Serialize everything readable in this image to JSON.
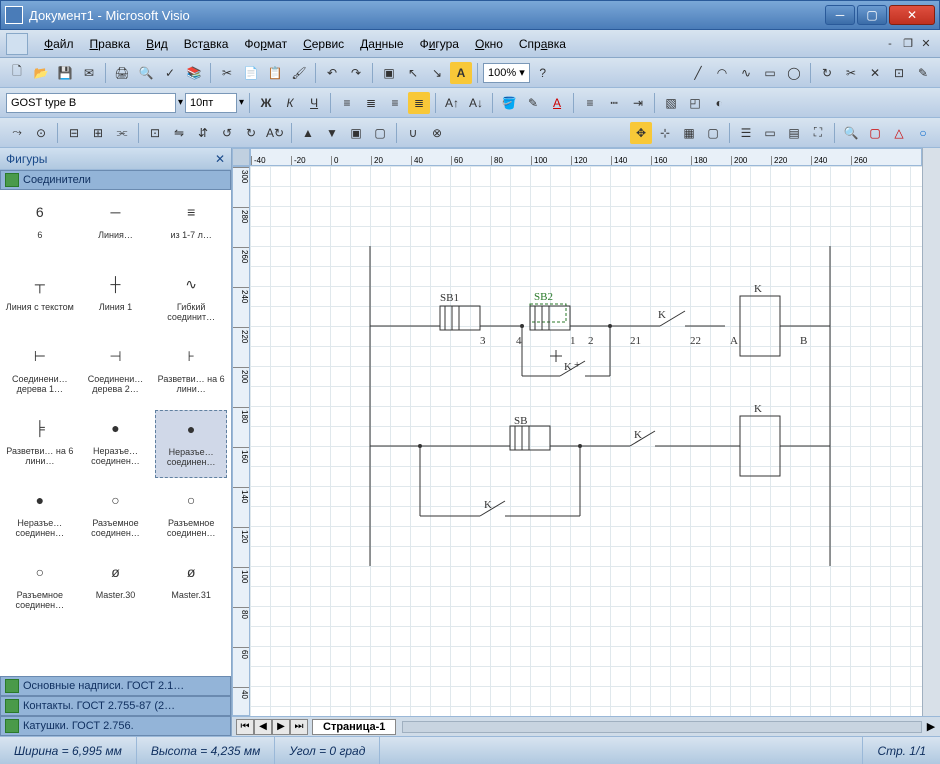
{
  "title": "Документ1 - Microsoft Visio",
  "menu": [
    "Файл",
    "Правка",
    "Вид",
    "Вставка",
    "Формат",
    "Сервис",
    "Данные",
    "Фигура",
    "Окно",
    "Справка"
  ],
  "font": {
    "name": "GOST type B",
    "size": "10пт"
  },
  "zoom": "100%",
  "shapes_panel": {
    "title": "Фигуры",
    "active_stencil": "Соединители",
    "items": [
      {
        "label": "6",
        "sub": ""
      },
      {
        "label": "Линия…",
        "sub": ""
      },
      {
        "label": "из 1-7 л…",
        "sub": ""
      },
      {
        "label": "Линия с текстом",
        "sub": ""
      },
      {
        "label": "Линия 1",
        "sub": ""
      },
      {
        "label": "Гибкий соединит…",
        "sub": ""
      },
      {
        "label": "Соединени… дерева 1…",
        "sub": ""
      },
      {
        "label": "Соединени… дерева 2…",
        "sub": ""
      },
      {
        "label": "Разветви… на 6 лини…",
        "sub": ""
      },
      {
        "label": "Разветви… на 6 лини…",
        "sub": ""
      },
      {
        "label": "Неразъе… соединен…",
        "sub": ""
      },
      {
        "label": "Неразъе… соединен…",
        "sub": "",
        "selected": true
      },
      {
        "label": "Неразъе… соединен…",
        "sub": ""
      },
      {
        "label": "Разъемное соединен…",
        "sub": ""
      },
      {
        "label": "Разъемное соединен…",
        "sub": ""
      },
      {
        "label": "Разъемное соединен…",
        "sub": ""
      },
      {
        "label": "Master.30",
        "sub": ""
      },
      {
        "label": "Master.31",
        "sub": ""
      }
    ],
    "other_stencils": [
      "Основные надписи. ГОСТ 2.1…",
      "Контакты. ГОСТ 2.755-87 (2…",
      "Катушки. ГОСТ 2.756."
    ]
  },
  "diagram": {
    "labels": {
      "sb1": "SB1",
      "sb2": "SB2",
      "sb": "SB",
      "k": "K"
    },
    "nodes": [
      "1",
      "2",
      "3",
      "4",
      "21",
      "22",
      "A",
      "B"
    ]
  },
  "page_tab": "Страница-1",
  "status": {
    "width": "Ширина = 6,995 мм",
    "height": "Высота = 4,235 мм",
    "angle": "Угол = 0 град",
    "page": "Стр. 1/1"
  },
  "ruler_marks_h": [
    "-40",
    "-20",
    "0",
    "20",
    "40",
    "60",
    "80",
    "100",
    "120",
    "140",
    "160",
    "180",
    "200",
    "220",
    "240",
    "260"
  ],
  "ruler_marks_v": [
    "300",
    "280",
    "260",
    "240",
    "220",
    "200",
    "180",
    "160",
    "140",
    "120",
    "100",
    "80",
    "60",
    "40"
  ]
}
